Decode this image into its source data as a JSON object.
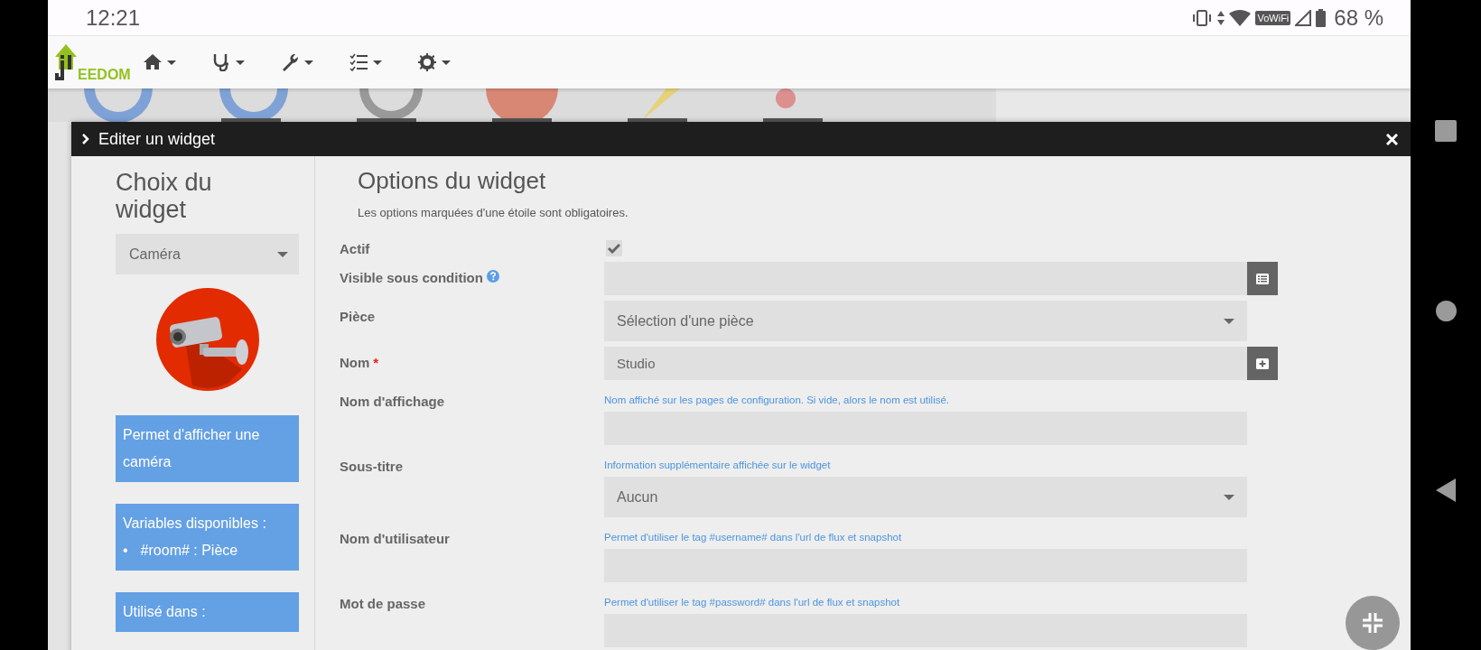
{
  "status_bar": {
    "time": "12:21",
    "vowifi": "VoWiFi",
    "battery": "68 %"
  },
  "nav_bar": {
    "logo": "EEDOM"
  },
  "modal": {
    "title": "Editer un widget"
  },
  "sidebar": {
    "title": "Choix du widget",
    "widget_select": "Caméra",
    "description": "Permet d'afficher une caméra",
    "variables": {
      "title": "Variables disponibles :",
      "items": [
        {
          "bullet": "•",
          "text": "#room# : Pièce"
        }
      ]
    },
    "used_in": "Utilisé dans :"
  },
  "form": {
    "title": "Options du widget",
    "note": "Les options marquées d'une étoile sont obligatoires.",
    "fields": [
      {
        "kind": "checkbox",
        "label": "Actif",
        "checked": true,
        "help": false
      },
      {
        "kind": "input",
        "label": "Visible sous condition",
        "help": true,
        "action": {
          "kind": "list"
        }
      },
      {
        "kind": "select",
        "label": "Pièce",
        "value": "Sélection d'une pièce",
        "help": false
      },
      {
        "kind": "input",
        "label": "Nom",
        "required_mark": "*",
        "value": "Studio",
        "help": false,
        "action": {
          "kind": "plus"
        }
      },
      {
        "kind": "input",
        "label": "Nom d'affichage",
        "hint": "Nom affiché sur les pages de configuration. Si vide, alors le nom est utilisé.",
        "help": false
      },
      {
        "kind": "select",
        "label": "Sous-titre",
        "hint": "Information supplémentaire affichée sur le widget",
        "value": "Aucun",
        "help": false
      },
      {
        "kind": "input",
        "label": "Nom d'utilisateur",
        "hint": "Permet d'utiliser le tag #username# dans l'url de flux et snapshot",
        "help": false
      },
      {
        "kind": "input",
        "label": "Mot de passe",
        "hint": "Permet d'utiliser le tag #password# dans l'url de flux et snapshot",
        "help": false
      }
    ]
  }
}
